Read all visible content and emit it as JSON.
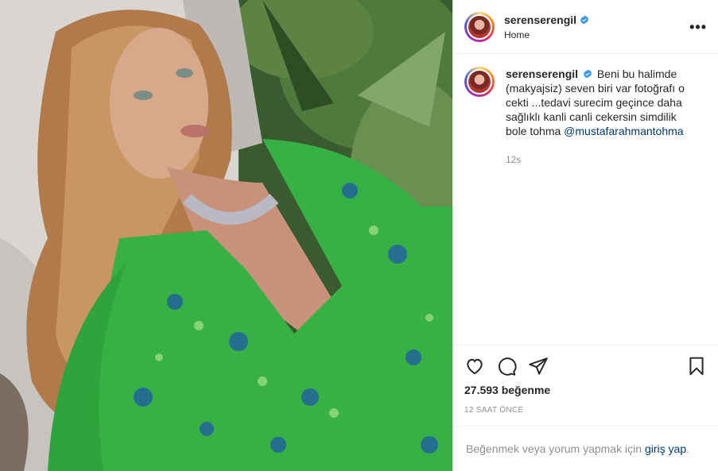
{
  "post": {
    "image_alt": "photo",
    "header": {
      "username": "serenserengil",
      "location": "Home",
      "more_label": "•••"
    },
    "caption": {
      "username": "serenserengil",
      "text": "Beni bu halimde (makyajsiz) seven biri var fotoğrafı o cekti ...tedavi surecim geçince daha sağlıklı kanli canli cekersin simdilik bole tohma",
      "mention": "@mustafarahmantohma",
      "time": "12s"
    },
    "actions": {
      "like_icon": "heart-icon",
      "comment_icon": "comment-icon",
      "share_icon": "paper-plane-icon",
      "save_icon": "bookmark-icon"
    },
    "likes": "27.593 beğenme",
    "posted_ago": "12 SAAT ÖNCE",
    "login_prompt": {
      "text": "Beğenmek veya yorum yapmak için",
      "link": "giriş yap",
      "suffix": "."
    }
  },
  "colors": {
    "verified": "#3897f0",
    "link": "#00376b",
    "muted": "#8e8e8e",
    "border": "#efefef"
  }
}
